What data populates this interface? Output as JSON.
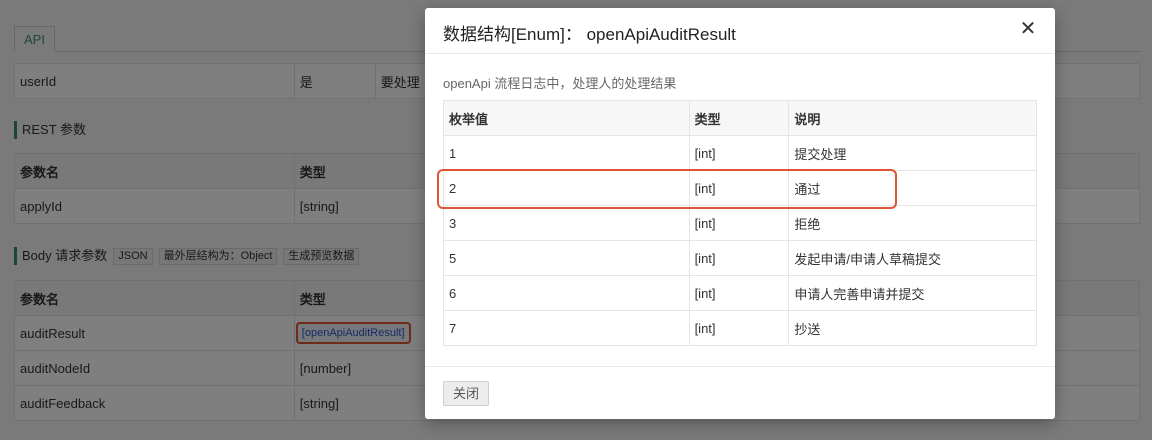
{
  "background": {
    "tab_label": "API",
    "query_row": {
      "name": "userId",
      "required": "是",
      "desc": "要处理"
    },
    "rest_section": {
      "title": "REST 参数"
    },
    "rest_table": {
      "headers": [
        "参数名",
        "类型"
      ],
      "rows": [
        {
          "name": "applyId",
          "type": "[string]"
        }
      ]
    },
    "body_section": {
      "title": "Body 请求参数",
      "json_chip": "JSON",
      "outer_chip": "最外层结构为：Object",
      "preview_chip": "生成预览数据"
    },
    "body_table": {
      "headers": [
        "参数名",
        "类型"
      ],
      "rows": [
        {
          "name": "auditResult",
          "type": "[openApiAuditResult]"
        },
        {
          "name": "auditNodeId",
          "type": "[number]"
        },
        {
          "name": "auditFeedback",
          "type": "[string]"
        }
      ]
    }
  },
  "modal": {
    "title": "数据结构[Enum]： openApiAuditResult",
    "close_icon": "close-icon",
    "description": "openApi 流程日志中，处理人的处理结果",
    "table": {
      "headers": [
        "枚举值",
        "类型",
        "说明"
      ],
      "rows": [
        {
          "value": "1",
          "type": "[int]",
          "desc": "提交处理"
        },
        {
          "value": "2",
          "type": "[int]",
          "desc": "通过"
        },
        {
          "value": "3",
          "type": "[int]",
          "desc": "拒绝"
        },
        {
          "value": "5",
          "type": "[int]",
          "desc": "发起申请/申请人草稿提交"
        },
        {
          "value": "6",
          "type": "[int]",
          "desc": "申请人完善申请并提交"
        },
        {
          "value": "7",
          "type": "[int]",
          "desc": "抄送"
        }
      ]
    },
    "footer": {
      "close_label": "关闭"
    }
  },
  "colors": {
    "highlight": "#e05535",
    "accent": "#3c8d5c",
    "link": "#2d57c9"
  }
}
